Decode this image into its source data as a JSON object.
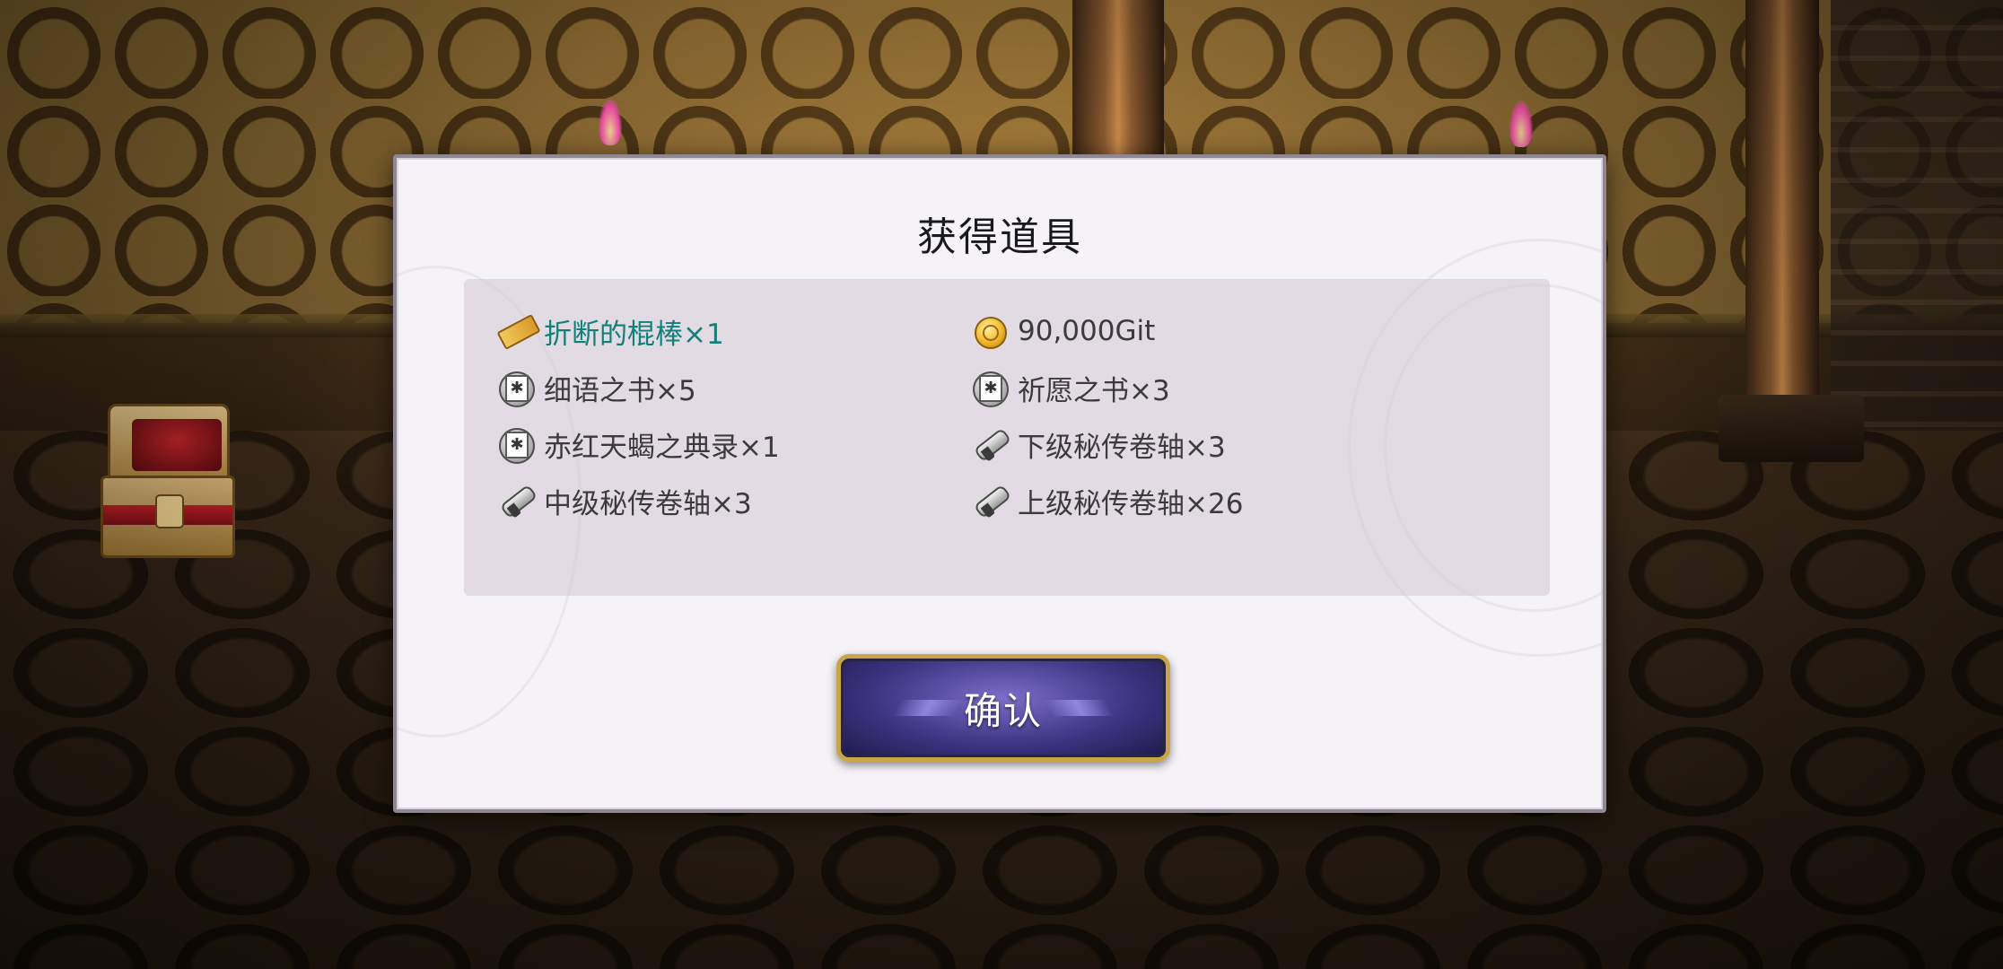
{
  "dialog": {
    "title": "获得道具",
    "items": [
      {
        "label": "折断的棍棒×1",
        "icon": "broken-stick-icon",
        "highlight": true
      },
      {
        "label": "90,000Git",
        "icon": "gold-coin-icon",
        "highlight": false
      },
      {
        "label": "细语之书×5",
        "icon": "book-icon",
        "highlight": false
      },
      {
        "label": "祈愿之书×3",
        "icon": "book-icon",
        "highlight": false
      },
      {
        "label": "赤红天蝎之典录×1",
        "icon": "book-icon",
        "highlight": false
      },
      {
        "label": "下级秘传卷轴×3",
        "icon": "scroll-icon",
        "highlight": false
      },
      {
        "label": "中级秘传卷轴×3",
        "icon": "scroll-icon",
        "highlight": false
      },
      {
        "label": "上级秘传卷轴×26",
        "icon": "scroll-icon",
        "highlight": false
      }
    ],
    "confirm_label": "确认"
  },
  "colors": {
    "highlight_text": "#127f78",
    "item_text": "#3b3b3b",
    "dialog_bg": "#f6f3f8",
    "button_border": "#c7a54b",
    "button_fill": "#3e3584"
  }
}
